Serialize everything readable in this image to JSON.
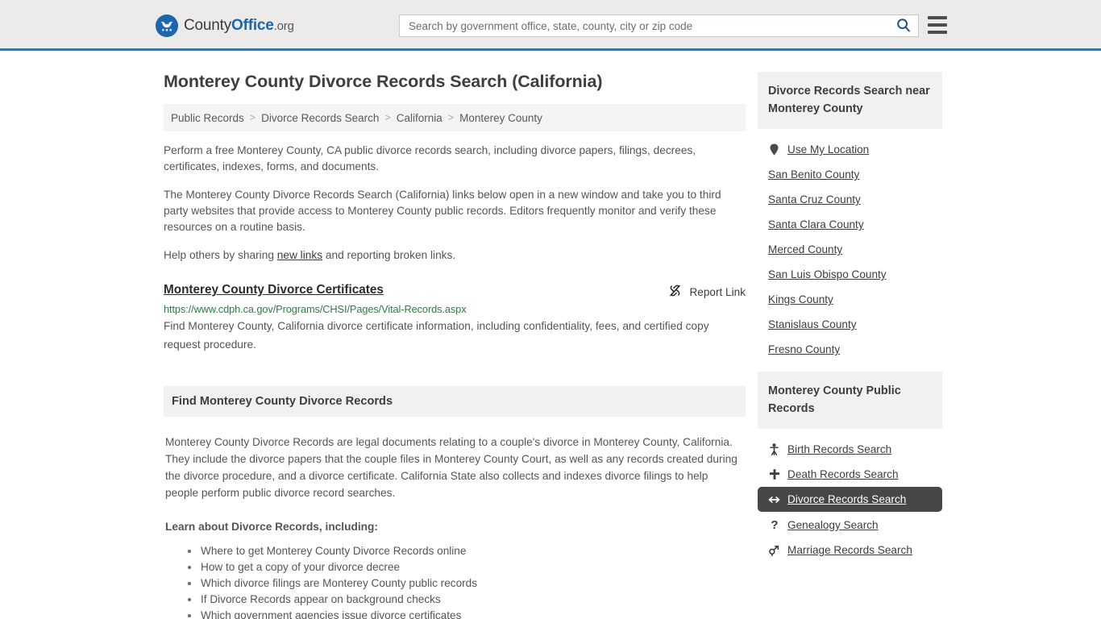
{
  "header": {
    "logo": {
      "text_1": "County",
      "text_2": "Office",
      "text_3": ".org"
    },
    "search": {
      "placeholder": "Search by government office, state, county, city or zip code",
      "value": "",
      "icon": "search-icon"
    },
    "menu_icon": "hamburger-menu-icon",
    "accent_color": "#3b76a8",
    "background_color": "#ecebe9"
  },
  "main": {
    "title": "Monterey County Divorce Records Search (California)",
    "breadcrumb": [
      "Public Records",
      "Divorce Records Search",
      "California",
      "Monterey County"
    ],
    "breadcrumb_separator": ">",
    "paragraphs": {
      "p1": "Perform a free Monterey County, CA public divorce records search, including divorce papers, filings, decrees, certificates, indexes, forms, and documents.",
      "p2": "The Monterey County Divorce Records Search (California) links below open in a new window and take you to third party websites that provide access to Monterey County public records. Editors frequently monitor and verify these resources on a routine basis.",
      "p3_before": "Help others by sharing ",
      "p3_link": "new links",
      "p3_after": " and reporting broken links."
    },
    "result": {
      "title": "Monterey County Divorce Certificates",
      "url": "https://www.cdph.ca.gov/Programs/CHSI/Pages/Vital-Records.aspx",
      "description": "Find Monterey County, California divorce certificate information, including confidentiality, fees, and certified copy request procedure.",
      "report_label": "Report Link",
      "report_icon": "broken-link-icon",
      "url_color": "#2d7d41"
    },
    "section": {
      "heading": "Find Monterey County Divorce Records",
      "body": "Monterey County Divorce Records are legal documents relating to a couple's divorce in Monterey County, California. They include the divorce papers that the couple files in Monterey County Court, as well as any records created during the divorce procedure, and a divorce certificate. California State also collects and indexes divorce filings to help people perform public divorce record searches.",
      "learn_heading": "Learn about Divorce Records, including:",
      "learn_items": [
        "Where to get Monterey County Divorce Records online",
        "How to get a copy of your divorce decree",
        "Which divorce filings are Monterey County public records",
        "If Divorce Records appear on background checks",
        "Which government agencies issue divorce certificates"
      ]
    }
  },
  "sidebar": {
    "nearby": {
      "heading": "Divorce Records Search near Monterey County",
      "use_location": {
        "label": "Use My Location",
        "icon": "map-pin-icon"
      },
      "counties": [
        "San Benito County",
        "Santa Cruz County",
        "Santa Clara County",
        "Merced County",
        "San Luis Obispo County",
        "Kings County",
        "Stanislaus County",
        "Fresno County"
      ]
    },
    "public_records": {
      "heading": "Monterey County Public Records",
      "active_highlight_color": "#474747",
      "items": [
        {
          "label": "Birth Records Search",
          "icon": "baby-icon",
          "active": false
        },
        {
          "label": "Death Records Search",
          "icon": "cross-icon",
          "active": false
        },
        {
          "label": "Divorce Records Search",
          "icon": "left-right-arrow-icon",
          "active": true
        },
        {
          "label": "Genealogy Search",
          "icon": "question-mark-icon",
          "active": false
        },
        {
          "label": "Marriage Records Search",
          "icon": "male-female-icon",
          "active": false
        }
      ]
    }
  }
}
